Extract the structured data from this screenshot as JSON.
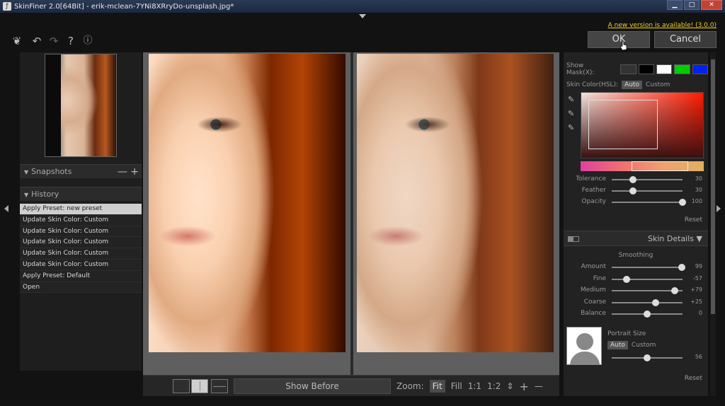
{
  "window": {
    "title": "SkinFiner 2.0[64Bit] - erik-mclean-7YNi8XRryDo-unsplash.jpg*",
    "min_glyph": "▁",
    "max_glyph": "□",
    "close_glyph": "✕"
  },
  "toolbar": {
    "tools": [
      {
        "name": "feather-icon",
        "glyph": "❦"
      },
      {
        "name": "undo-icon",
        "glyph": "↶"
      },
      {
        "name": "redo-icon",
        "glyph": "↷"
      },
      {
        "name": "help-icon",
        "glyph": "?"
      },
      {
        "name": "info-icon",
        "glyph": "ⓘ"
      }
    ],
    "update_notice": "A new version is available! (3.0.0)",
    "ok_label": "OK",
    "cancel_label": "Cancel"
  },
  "left_panel": {
    "snapshots": {
      "label": "Snapshots",
      "minus": "—",
      "plus": "+"
    },
    "history": {
      "label": "History",
      "items": [
        "Apply Preset: new preset",
        "Update Skin Color: Custom",
        "Update Skin Color: Custom",
        "Update Skin Color: Custom",
        "Update Skin Color: Custom",
        "Update Skin Color: Custom",
        "Apply Preset: Default",
        "Open"
      ],
      "selected_index": 0
    }
  },
  "viewbar": {
    "show_before_label": "Show Before",
    "zoom_label": "Zoom:",
    "zoom_options": [
      "Fit",
      "Fill",
      "1:1",
      "1:2"
    ],
    "zoom_selected": "Fit",
    "zoom_stepper": "⇕",
    "zoom_in": "+",
    "zoom_out": "—"
  },
  "right_panel": {
    "show_mask_label": "Show Mask(X):",
    "mask_colors": [
      "#000000",
      "#ffffff",
      "#00cc00",
      "#0022ee"
    ],
    "skin_color_label": "Skin Color(HSL):",
    "skin_auto": "Auto",
    "skin_custom": "Custom",
    "color_sliders": [
      {
        "label": "Tolerance",
        "value": 30,
        "pos": 0.3
      },
      {
        "label": "Feather",
        "value": 30,
        "pos": 0.3
      },
      {
        "label": "Opacity",
        "value": 100,
        "pos": 1.0
      }
    ],
    "reset_label": "Reset",
    "skin_details_label": "Skin Details",
    "smoothing_label": "Smoothing",
    "smoothing_sliders": [
      {
        "label": "Amount",
        "value": "99",
        "pos": 0.99
      },
      {
        "label": "Fine",
        "value": "-57",
        "pos": 0.21
      },
      {
        "label": "Medium",
        "value": "+79",
        "pos": 0.89
      },
      {
        "label": "Coarse",
        "value": "+25",
        "pos": 0.62
      },
      {
        "label": "Balance",
        "value": "0",
        "pos": 0.5
      }
    ],
    "portrait_size_label": "Portrait Size",
    "portrait_auto": "Auto",
    "portrait_custom": "Custom",
    "portrait_slider": {
      "value": "56",
      "pos": 0.5
    },
    "reset2_label": "Reset"
  }
}
